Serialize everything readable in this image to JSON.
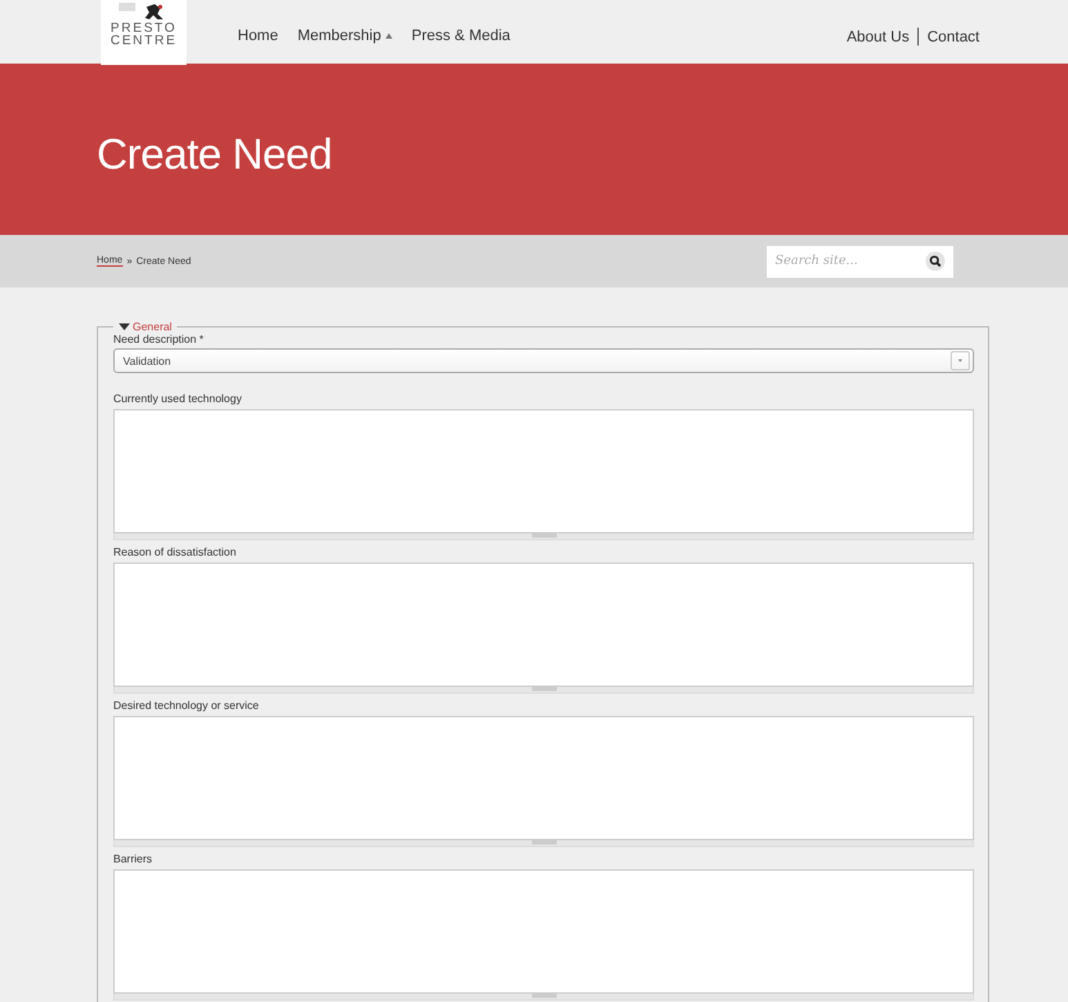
{
  "logo": {
    "line_1": "PRESTO",
    "line_2": "CENTRE"
  },
  "nav": [
    {
      "label": "Home",
      "has_menu": false
    },
    {
      "label": "Membership",
      "has_menu": true
    },
    {
      "label": "Press & Media",
      "has_menu": false
    }
  ],
  "utility_links": [
    "About Us",
    "Contact"
  ],
  "page_title": "Create Need",
  "breadcrumb": {
    "links": [
      "Home"
    ],
    "separator": "»",
    "current": "Create Need"
  },
  "search": {
    "placeholder": "Search site..."
  },
  "fieldset": {
    "legend": "General",
    "expanded": true,
    "select": {
      "label": "Need description *",
      "value": "Validation"
    },
    "textareas": [
      {
        "label": "Currently used technology"
      },
      {
        "label": "Reason of dissatisfaction"
      },
      {
        "label": "Desired technology or service"
      },
      {
        "label": "Barriers"
      }
    ]
  }
}
